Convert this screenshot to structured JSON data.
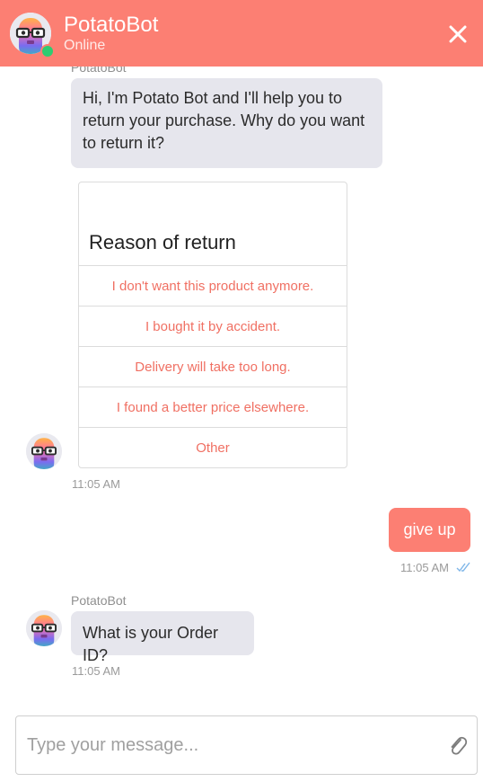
{
  "header": {
    "bot_name": "PotatoBot",
    "status": "Online",
    "close_icon": "close-icon",
    "status_color": "#2ecc71",
    "brand_color": "#fc7f73"
  },
  "messages": {
    "first_sender": "PotatoBot",
    "greeting": "Hi, I'm Potato Bot and I'll help you to return your purchase. Why do you want to return it?",
    "card": {
      "title": "Reason of return",
      "options": [
        "I don't want this product anymore.",
        "I bought it by accident.",
        "Delivery will take too long.",
        "I found a better price elsewhere.",
        "Other"
      ]
    },
    "card_time": "11:05 AM",
    "user_reply": "give up",
    "user_time": "11:05 AM",
    "second_sender": "PotatoBot",
    "question": "What is your Order ID?",
    "question_time": "11:05 AM"
  },
  "composer": {
    "placeholder": "Type your message...",
    "attach_icon": "paperclip-icon"
  }
}
